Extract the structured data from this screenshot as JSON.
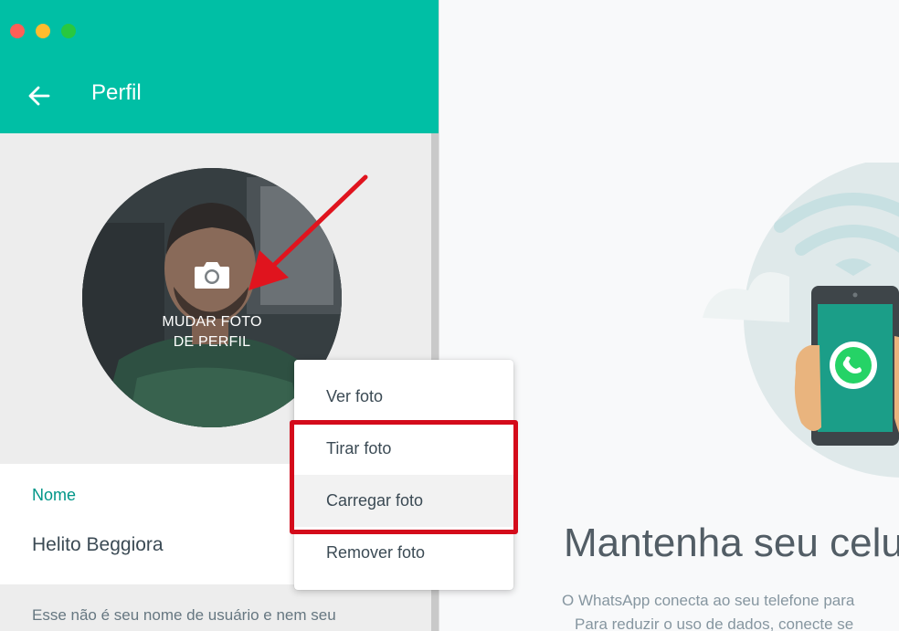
{
  "window": {
    "controls": [
      "close",
      "minimize",
      "maximize"
    ]
  },
  "header": {
    "title": "Perfil",
    "back_icon": "arrow-left-icon",
    "color": "#00bfa5"
  },
  "avatar": {
    "overlay_line1": "MUDAR FOTO",
    "overlay_line2": "DE PERFIL",
    "icon": "camera-icon"
  },
  "profile": {
    "name_label": "Nome",
    "name_value": "Helito Beggiora",
    "name_hint": "Esse não é seu nome de usuário e nem seu"
  },
  "menu": {
    "items": [
      {
        "label": "Ver foto"
      },
      {
        "label": "Tirar foto"
      },
      {
        "label": "Carregar foto"
      },
      {
        "label": "Remover foto"
      }
    ]
  },
  "main": {
    "headline": "Mantenha seu celu",
    "description_line1": "O WhatsApp conecta ao seu telefone para",
    "description_line2": "Para reduzir o uso de dados, conecte se"
  },
  "colors": {
    "accent": "#00bfa5",
    "highlight_box": "#d40b1b",
    "arrow": "#e0141e"
  }
}
